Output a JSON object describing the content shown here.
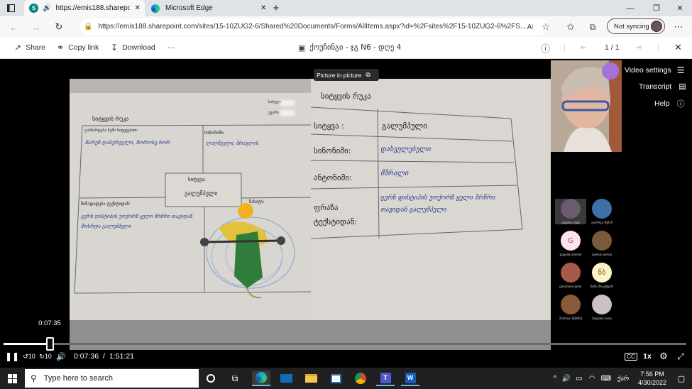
{
  "browser": {
    "tabs": [
      {
        "title": "https://emis188.sharepoint.",
        "icon": "sharepoint-icon",
        "active": true
      },
      {
        "title": "Microsoft Edge",
        "icon": "edge-icon",
        "active": false
      }
    ],
    "url": "https://emis188.sharepoint.com/sites/15-10ZUG2-6/Shared%20Documents/Forms/AllItems.aspx?id=%2Fsites%2F15-10ZUG2-6%2FS...",
    "sync_label": "Not syncing"
  },
  "toolbar": {
    "share": "Share",
    "copy_link": "Copy link",
    "download": "Download",
    "more": "···",
    "file_title": "ქოუჩინგი - ჯგ N6 - დღე 4",
    "page_count": "1 / 1"
  },
  "video": {
    "pip_label": "Picture in picture",
    "menu": [
      {
        "label": "Video settings"
      },
      {
        "label": "Transcript"
      },
      {
        "label": "Help"
      }
    ],
    "hover_time": "0:07:35",
    "current_time": "0:07:36",
    "separator": "/",
    "total_time": "1:51:21",
    "progress": 0.068,
    "speed": "1x",
    "participants": [
      {
        "name": "gogoita.magi",
        "kind": "photo",
        "color": "#6b5a70"
      },
      {
        "name": "გიორგი მუზაშ",
        "kind": "photo",
        "color": "#3f6fa8"
      },
      {
        "name": "gogoita.mariset",
        "kind": "initial",
        "initial": "G",
        "color": "#fde4ec",
        "fg": "#b8336a"
      },
      {
        "name": "davituri.avmat",
        "kind": "photo",
        "color": "#7a5a3a"
      },
      {
        "name": "goncharo.tamar",
        "kind": "photo",
        "color": "#a55a4a"
      },
      {
        "name": "ნინა მოკიტუარ",
        "kind": "initial",
        "initial": "ნბ",
        "color": "#fdf3c8",
        "fg": "#7a5b00"
      },
      {
        "name": "მართაი მენსსქ",
        "kind": "photo",
        "color": "#8a5a3a"
      },
      {
        "name": "bagratio.naria",
        "kind": "photo",
        "color": "#c9c0c8"
      }
    ],
    "worksheet_left": {
      "title": "სიტყვის რუკა",
      "top_right_small_1": "სახელი:",
      "top_right_small_2": "გვარი:",
      "meaning_label": "განმარტება ჩემი სიტყვებით:",
      "meaning_text": "მარენ დასურველი, მოროსე ხორ",
      "synonym_label": "სინონიმი:",
      "synonym_text": "ლაღმეული, მრავლის",
      "word_label": "სიტყვა:",
      "word_value": "გალუმპული",
      "sentence_label": "წინადადება ტექსტიდან:",
      "sentence_text": "ცურნ დისტიპის უოქორზ ყელი მრწრი თავიდან მოსრდა გალუმპული",
      "drawing_label": "ნახატი:"
    },
    "worksheet_right": {
      "title": "სიტყვის რუკა",
      "rows": [
        {
          "label": "სიტყვა :",
          "value": "გალუმპული"
        },
        {
          "label": "სინონიმი:",
          "value": "დასველებული"
        },
        {
          "label": "ანტონიმი:",
          "value": "მშრალი"
        },
        {
          "label": "ფრაზა ტექსტიდან:",
          "value": "ცურნ დისტიპის უოქორზ ყელი მრწრი თავიდან გალუმპული"
        }
      ]
    }
  },
  "taskbar": {
    "search_placeholder": "Type here to search",
    "lang": "ქარ",
    "time": "7:56 PM",
    "date": "4/30/2022"
  }
}
